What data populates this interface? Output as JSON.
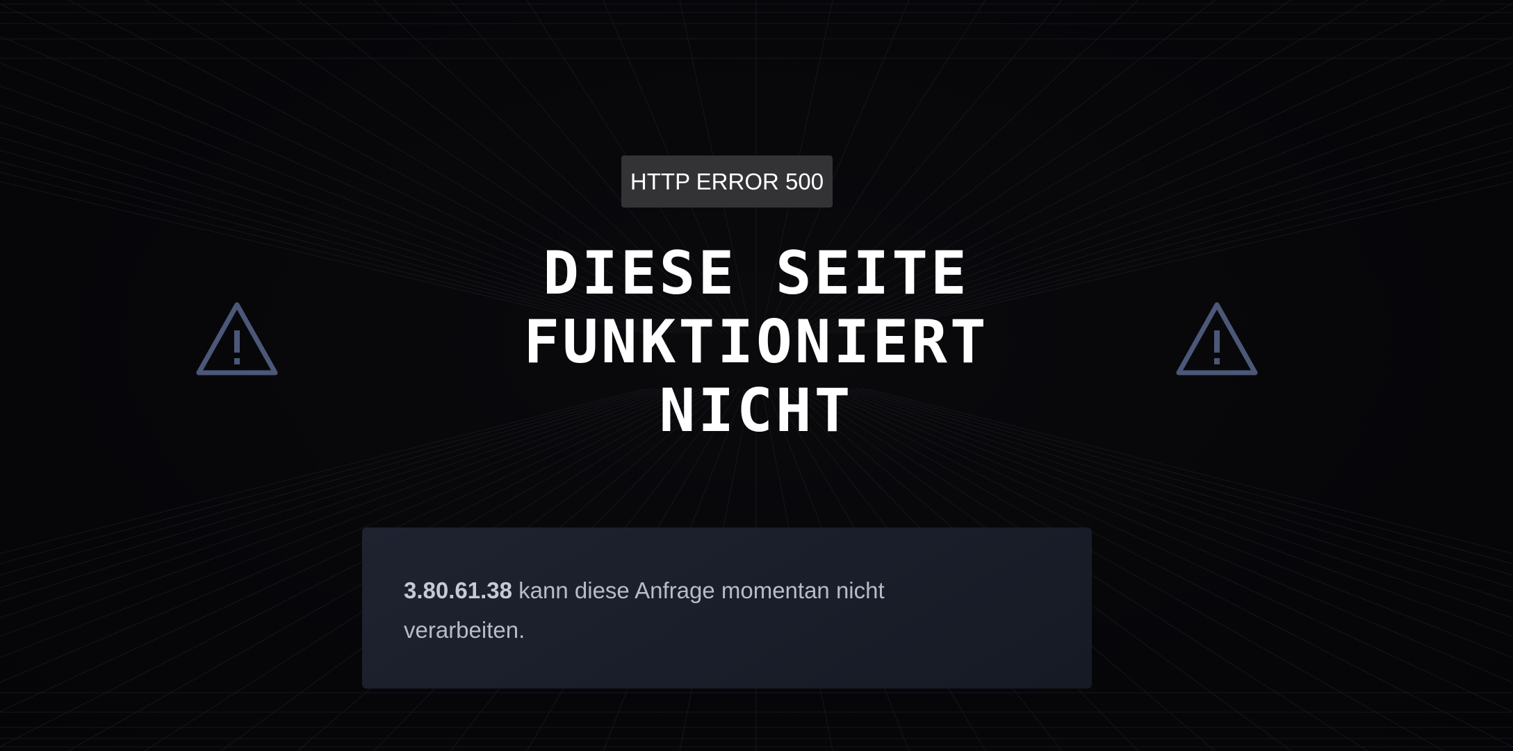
{
  "error": {
    "badge": "HTTP ERROR 500",
    "headline_lines": [
      "DIESE SEITE",
      "FUNKTIONIERT",
      "NICHT"
    ],
    "ip": "3.80.61.38",
    "message": " kann diese Anfrage momentan nicht verarbeiten."
  },
  "icons": {
    "left": "warning-triangle-icon",
    "right": "warning-triangle-icon"
  },
  "colors": {
    "background": "#07070a",
    "badge_bg": "#333335",
    "icon": "#4b5878",
    "card_bg": "#1c202c",
    "text": "#b7bcc9"
  }
}
